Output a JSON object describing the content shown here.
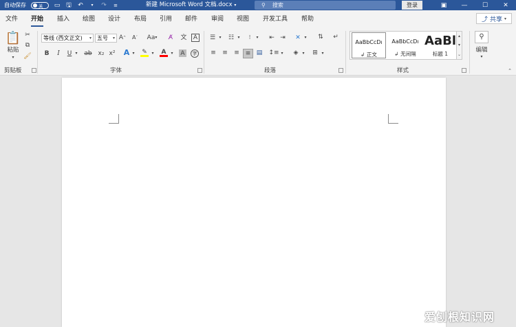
{
  "titlebar": {
    "autosave_label": "自动保存",
    "autosave_state": "关",
    "doc_title": "新建 Microsoft Word 文档.docx",
    "search_placeholder": "搜索",
    "login_label": "登录"
  },
  "tabs": [
    "文件",
    "开始",
    "插入",
    "绘图",
    "设计",
    "布局",
    "引用",
    "邮件",
    "审阅",
    "视图",
    "开发工具",
    "帮助"
  ],
  "active_tab": "开始",
  "share_label": "共享",
  "clipboard": {
    "paste_label": "粘贴",
    "group_label": "剪贴板"
  },
  "font": {
    "font_name": "等线 (西文正文)",
    "font_size": "五号",
    "case_label": "Aa",
    "bold": "B",
    "italic": "I",
    "underline": "U",
    "strike": "ab",
    "subscript": "x₂",
    "superscript": "x²",
    "group_label": "字体"
  },
  "paragraph": {
    "group_label": "段落"
  },
  "styles": {
    "items": [
      {
        "sample": "AaBbCcDı",
        "name": "↲ 正文"
      },
      {
        "sample": "AaBbCcDı",
        "name": "↲ 无间隔"
      },
      {
        "sample": "AaBl",
        "name": "标题 1"
      }
    ],
    "group_label": "样式"
  },
  "editing": {
    "label": "编辑"
  },
  "watermark": "爱刨根知识网",
  "colors": {
    "titlebar": "#2b579a",
    "highlight": "#ffff00",
    "font_color": "#ff0000"
  }
}
